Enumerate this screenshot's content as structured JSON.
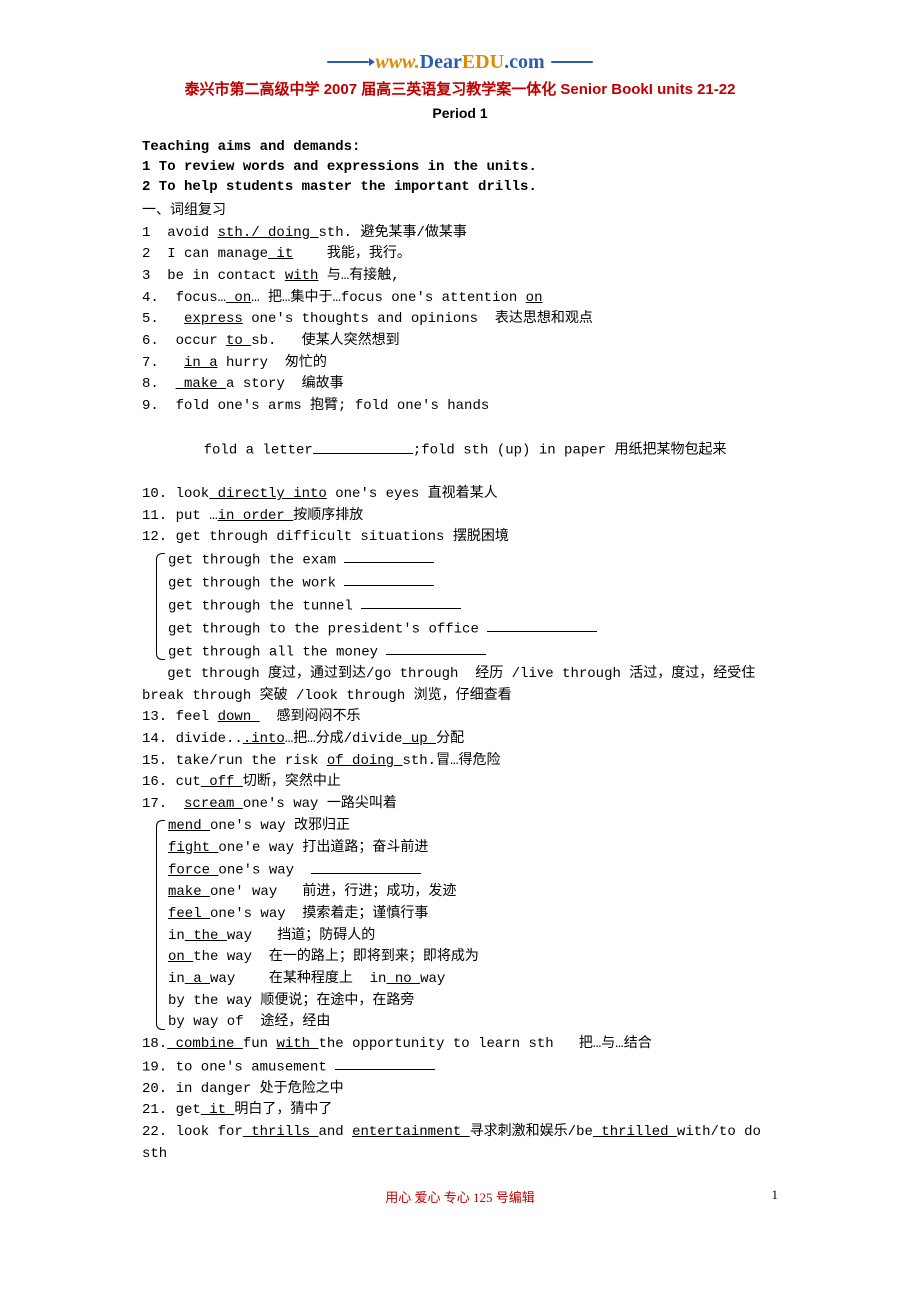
{
  "header": {
    "site_www": "www.",
    "site_dear": "Dear",
    "site_edu": "EDU",
    "site_com": ".com"
  },
  "title": "泰兴市第二高级中学 2007 届高三英语复习教学案一体化 Senior BookI units 21-22",
  "period": "Period 1",
  "section_head": "Teaching aims and demands:",
  "aim1": "1 To review words and expressions in the units.",
  "aim2": "2 To help students master the important drills.",
  "section_cn": "一、词组复习",
  "lines": [
    {
      "num": "1",
      "pre": "avoid ",
      "u": "sth./ doing ",
      "post": "sth. 避免某事/做某事"
    },
    {
      "num": "2",
      "pre": "I can manage",
      "u": " it",
      "post": "    我能，我行。"
    },
    {
      "num": "3",
      "pre": "be in contact ",
      "u": "with",
      "post": " 与…有接触,"
    },
    {
      "num": "4.",
      "pre": "focus…",
      "u": " on",
      "post": "… 把…集中于…focus one's attention ",
      "u2": "on"
    },
    {
      "num": "5.",
      "pre": " ",
      "u": "express",
      "post": " one's thoughts and opinions  表达思想和观点"
    },
    {
      "num": "6.",
      "pre": "occur ",
      "u": "to ",
      "post": "sb.   使某人突然想到"
    },
    {
      "num": "7.",
      "pre": " ",
      "u": "in a",
      "post": " hurry  匆忙的"
    },
    {
      "num": "8.",
      "pre": "",
      "u": " make ",
      "post": "a story  编故事"
    },
    {
      "num": "9.",
      "pre": "fold one's arms 抱臂; fold one's hands",
      "u": "",
      "post": ""
    }
  ],
  "line9b_pre": "fold a letter",
  "line9b_post": ";fold sth (up) in paper 用纸把某物包起来",
  "line10_pre": "10. look",
  "line10_u": " directly into",
  "line10_post": " one's eyes 直视着某人",
  "line11_pre": "11. put …",
  "line11_u": "in order ",
  "line11_post": "按顺序排放",
  "line12head": "12. get through difficult situations 摆脱困境",
  "group12": [
    {
      "t": "get through the exam ",
      "blank": 90
    },
    {
      "t": "get through the work ",
      "blank": 90
    },
    {
      "t": "get through the tunnel ",
      "blank": 100
    },
    {
      "t": "get through to the president's office ",
      "blank": 110
    },
    {
      "t": "get through all the money ",
      "blank": 100
    }
  ],
  "line12tail": "   get through 度过，通过到达/go through  经历 /live through 活过，度过，经受住 break through 突破 /look through 浏览，仔细查看",
  "line13_pre": "13. feel ",
  "line13_u": "down ",
  "line13_post": "  感到闷闷不乐",
  "line14_pre": "14. divide..",
  "line14_u": ".into",
  "line14_mid": "…把…分成/divide",
  "line14_u2": " up ",
  "line14_post": "分配",
  "line15_pre": "15. take/run the risk ",
  "line15_u": "of doing ",
  "line15_post": "sth.冒…得危险",
  "line16_pre": "16. cut",
  "line16_u": " off ",
  "line16_post": "切断，突然中止",
  "line17_pre": "17.  ",
  "line17_u": "scream ",
  "line17_post": "one's way 一路尖叫着",
  "group17": [
    {
      "u": "mend ",
      "t": "one's way 改邪归正"
    },
    {
      "u": "fight ",
      "t": "one'e way 打出道路；奋斗前进"
    },
    {
      "u": "force ",
      "t": "one's way  ",
      "blank": 110
    },
    {
      "u": "make ",
      "t": "one' way   前进，行进；成功，发迹"
    },
    {
      "u": "feel ",
      "t": "one's way  摸索着走；谨慎行事"
    },
    {
      "pre": "in",
      "u": " the ",
      "t": "way   挡道；防碍人的"
    },
    {
      "u": "on ",
      "t": "the way  在一的路上；即将到来；即将成为"
    },
    {
      "pre": "in",
      "u": " a ",
      "t": "way    在某种程度上  in",
      "u2": " no ",
      "t2": "way"
    },
    {
      "t": "by the way 顺便说；在途中，在路旁"
    },
    {
      "t": "by way of  途经，经由"
    }
  ],
  "line18_pre": "18.",
  "line18_u": " combine ",
  "line18_mid": "fun ",
  "line18_u2": "with ",
  "line18_post": "the opportunity to learn sth   把…与…结合",
  "line19_pre": "19. to one's amusement ",
  "line19_blank": 100,
  "line20": "20. in danger 处于危险之中",
  "line21_pre": "21. get",
  "line21_u": " it ",
  "line21_post": "明白了，猜中了",
  "line22_pre": "22. look for",
  "line22_u": " thrills ",
  "line22_mid": "and ",
  "line22_u2": "entertainment ",
  "line22_mid2": "寻求刺激和娱乐/be",
  "line22_u3": " thrilled ",
  "line22_post": "with/to do sth",
  "footer_text": "用心 爱心 专心  125 号编辑",
  "footer_page": "1"
}
